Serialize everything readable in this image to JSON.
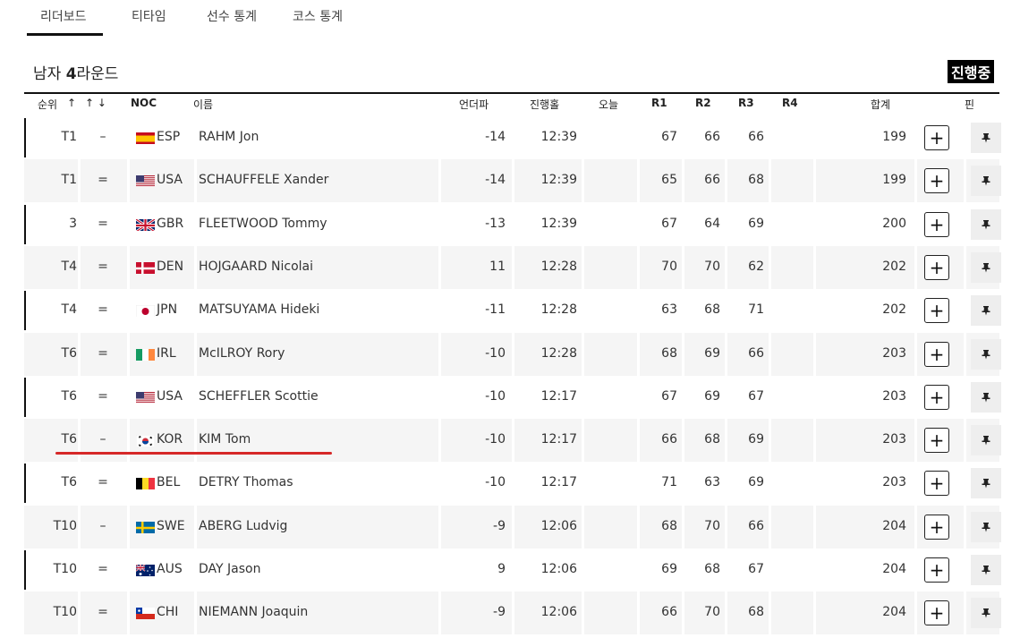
{
  "tabs": [
    {
      "label": "리더보드"
    },
    {
      "label": "티타임"
    },
    {
      "label": "선수 통계"
    },
    {
      "label": "코스 통계"
    }
  ],
  "round_title_a": "남자 ",
  "round_title_b": "4",
  "round_title_c": "라운드",
  "live_badge": "진행중",
  "headers": {
    "rank": "순위",
    "sort_up": "↑",
    "sort_updown": "↑ ↓",
    "noc": "NOC",
    "name": "이름",
    "to_par": "언더파",
    "thru": "진행홀",
    "today": "오늘",
    "r1": "R1",
    "r2": "R2",
    "r3": "R3",
    "r4": "R4",
    "total": "합계",
    "pin": "핀"
  },
  "rows": [
    {
      "rank": "T1",
      "move": "–",
      "noc": "ESP",
      "flag": "esp",
      "name": "RAHM Jon",
      "to_par": "-14",
      "thru": "12:39",
      "today": "",
      "r1": "67",
      "r2": "66",
      "r3": "66",
      "r4": "",
      "total": "199"
    },
    {
      "rank": "T1",
      "move": "=",
      "noc": "USA",
      "flag": "usa",
      "name": "SCHAUFFELE Xander",
      "to_par": "-14",
      "thru": "12:39",
      "today": "",
      "r1": "65",
      "r2": "66",
      "r3": "68",
      "r4": "",
      "total": "199"
    },
    {
      "rank": "3",
      "move": "=",
      "noc": "GBR",
      "flag": "gbr",
      "name": "FLEETWOOD Tommy",
      "to_par": "-13",
      "thru": "12:39",
      "today": "",
      "r1": "67",
      "r2": "64",
      "r3": "69",
      "r4": "",
      "total": "200"
    },
    {
      "rank": "T4",
      "move": "=",
      "noc": "DEN",
      "flag": "den",
      "name": "HOJGAARD Nicolai",
      "to_par": "11",
      "thru": "12:28",
      "today": "",
      "r1": "70",
      "r2": "70",
      "r3": "62",
      "r4": "",
      "total": "202"
    },
    {
      "rank": "T4",
      "move": "=",
      "noc": "JPN",
      "flag": "jpn",
      "name": "MATSUYAMA Hideki",
      "to_par": "-11",
      "thru": "12:28",
      "today": "",
      "r1": "63",
      "r2": "68",
      "r3": "71",
      "r4": "",
      "total": "202"
    },
    {
      "rank": "T6",
      "move": "=",
      "noc": "IRL",
      "flag": "irl",
      "name": "McILROY Rory",
      "to_par": "-10",
      "thru": "12:28",
      "today": "",
      "r1": "68",
      "r2": "69",
      "r3": "66",
      "r4": "",
      "total": "203"
    },
    {
      "rank": "T6",
      "move": "=",
      "noc": "USA",
      "flag": "usa",
      "name": "SCHEFFLER Scottie",
      "to_par": "-10",
      "thru": "12:17",
      "today": "",
      "r1": "67",
      "r2": "69",
      "r3": "67",
      "r4": "",
      "total": "203"
    },
    {
      "rank": "T6",
      "move": "–",
      "noc": "KOR",
      "flag": "kor",
      "name": "KIM Tom",
      "to_par": "-10",
      "thru": "12:17",
      "today": "",
      "r1": "66",
      "r2": "68",
      "r3": "69",
      "r4": "",
      "total": "203"
    },
    {
      "rank": "T6",
      "move": "=",
      "noc": "BEL",
      "flag": "bel",
      "name": "DETRY Thomas",
      "to_par": "-10",
      "thru": "12:17",
      "today": "",
      "r1": "71",
      "r2": "63",
      "r3": "69",
      "r4": "",
      "total": "203"
    },
    {
      "rank": "T10",
      "move": "–",
      "noc": "SWE",
      "flag": "swe",
      "name": "ABERG Ludvig",
      "to_par": "-9",
      "thru": "12:06",
      "today": "",
      "r1": "68",
      "r2": "70",
      "r3": "66",
      "r4": "",
      "total": "204"
    },
    {
      "rank": "T10",
      "move": "=",
      "noc": "AUS",
      "flag": "aus",
      "name": "DAY Jason",
      "to_par": "9",
      "thru": "12:06",
      "today": "",
      "r1": "69",
      "r2": "68",
      "r3": "67",
      "r4": "",
      "total": "204"
    },
    {
      "rank": "T10",
      "move": "=",
      "noc": "CHI",
      "flag": "chi",
      "name": "NIEMANN Joaquin",
      "to_par": "-9",
      "thru": "12:06",
      "today": "",
      "r1": "66",
      "r2": "70",
      "r3": "68",
      "r4": "",
      "total": "204"
    }
  ],
  "plus_label": "+",
  "colors": {
    "highlight": "#d62828",
    "badge_bg": "#000000",
    "row_alt": "#f5f5f5"
  }
}
